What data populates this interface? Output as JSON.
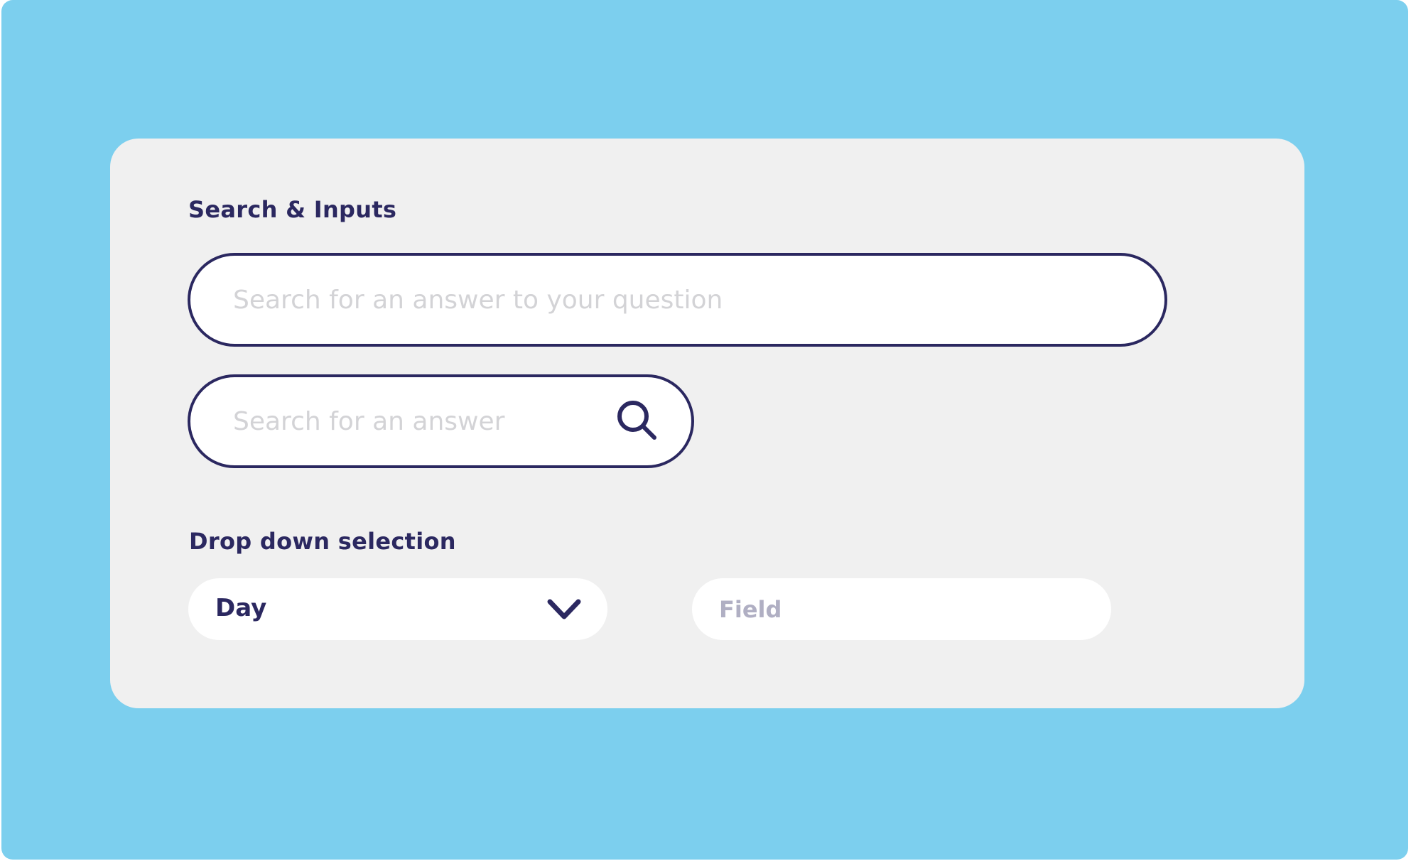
{
  "colors": {
    "background": "#7ccfee",
    "card": "#f0f0f0",
    "primary": "#2b2860",
    "placeholder": "#d3d3d6",
    "field_placeholder": "#b0afc3"
  },
  "search_section": {
    "title": "Search & Inputs",
    "search_wide": {
      "placeholder": "Search for an answer to your question"
    },
    "search_narrow": {
      "placeholder": "Search for an answer",
      "button_icon": "search-icon"
    }
  },
  "dropdown_section": {
    "title": "Drop down selection",
    "select": {
      "value": "Day",
      "icon": "chevron-down-icon"
    },
    "field": {
      "placeholder": "Field"
    }
  }
}
